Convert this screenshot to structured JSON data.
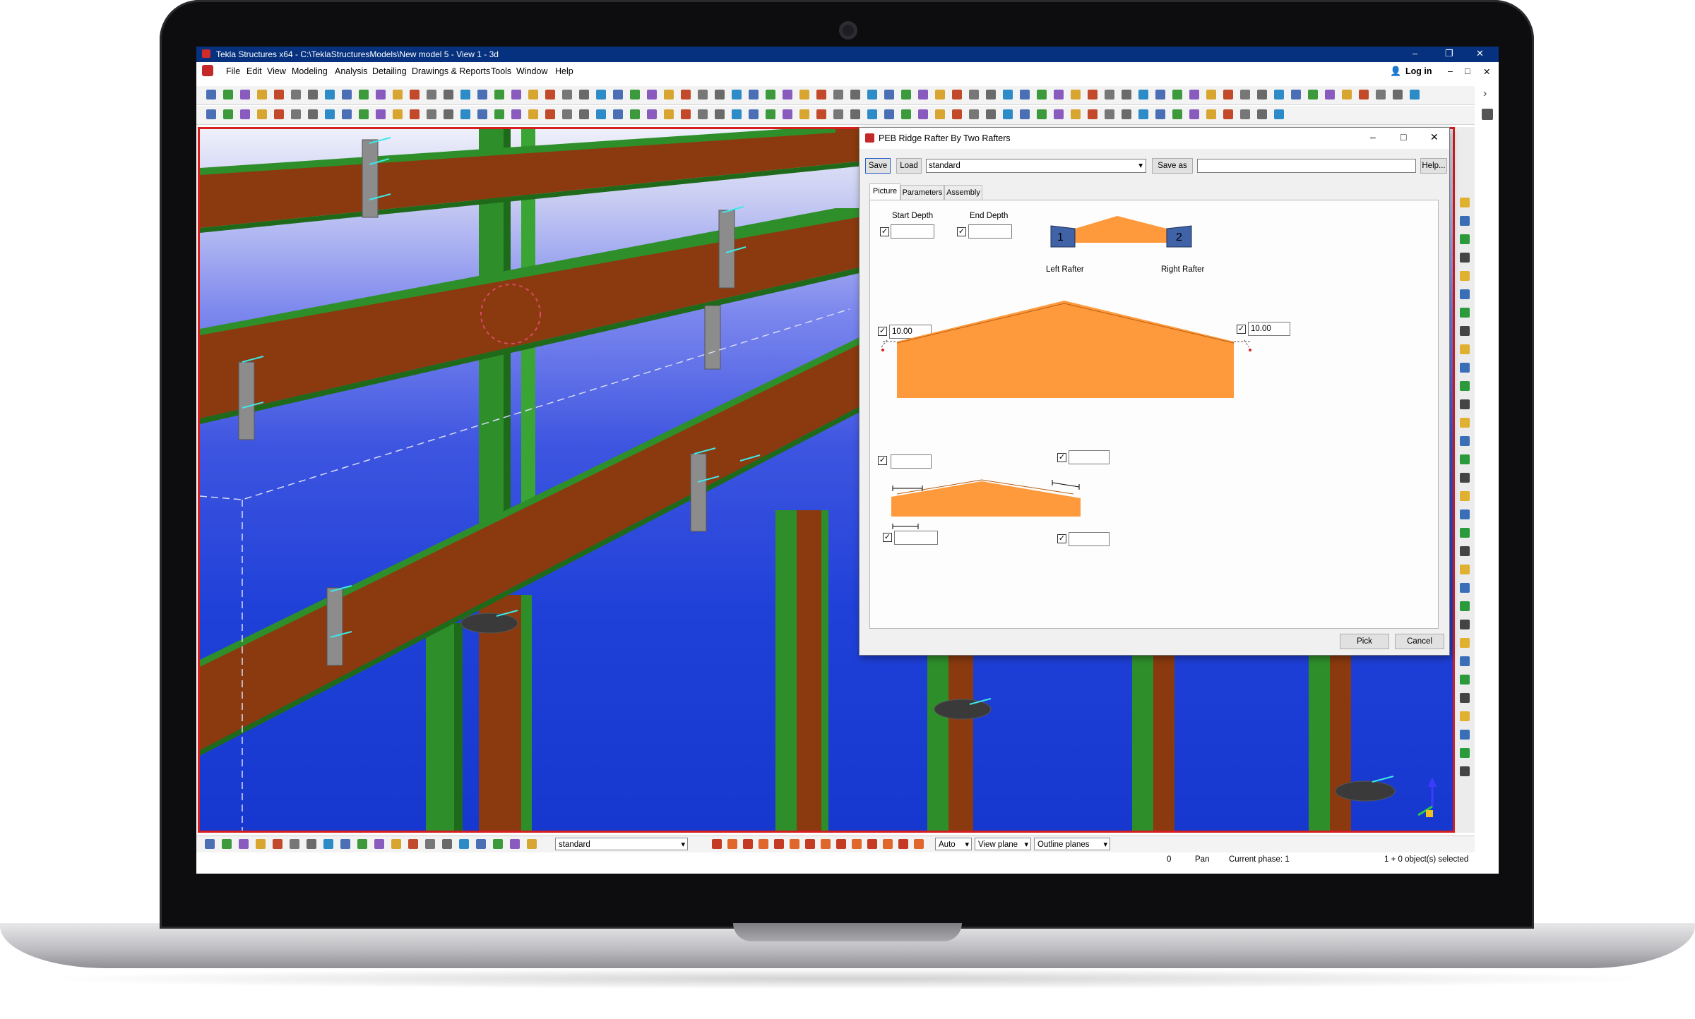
{
  "window": {
    "title": "Tekla Structures x64 - C:\\TeklaStructuresModels\\New model 5 - View 1 - 3d",
    "controls": [
      "–",
      "❐",
      "✕"
    ]
  },
  "menu": {
    "items": [
      "File",
      "Edit",
      "View",
      "Modeling",
      "Analysis",
      "Detailing",
      "Drawings & Reports",
      "Tools",
      "Window",
      "Help"
    ],
    "login": "Log in"
  },
  "dialog": {
    "title": "PEB Ridge Rafter By Two Rafters",
    "save": "Save",
    "load": "Load",
    "attribute_set": "standard",
    "save_as": "Save as",
    "save_as_name": "",
    "help": "Help...",
    "tabs": [
      "Picture",
      "Parameters",
      "Assembly"
    ],
    "active_tab": "Picture",
    "start_depth_label": "Start Depth",
    "end_depth_label": "End Depth",
    "start_depth": "",
    "end_depth": "",
    "left_rafter_label": "Left Rafter",
    "right_rafter_label": "Right Rafter",
    "rafter_1": "1",
    "rafter_2": "2",
    "left_offset": "10.00",
    "right_offset": "10.00",
    "pick": "Pick",
    "cancel": "Cancel"
  },
  "bottombar": {
    "filter": "standard",
    "snap_mode": "Auto",
    "plane": "View plane",
    "planes": "Outline planes"
  },
  "status": {
    "count": "0",
    "mode": "Pan",
    "phase": "Current phase: 1",
    "selection": "1 + 0 object(s) selected"
  },
  "colors": {
    "titlebar": "#05317e",
    "rafter": "#8a3a0e",
    "column_green": "#2e8f2a",
    "viewport_border": "#d61e1e",
    "dialog_shape": "#ff9a3c",
    "rafter_blue": "#3f63a6"
  }
}
